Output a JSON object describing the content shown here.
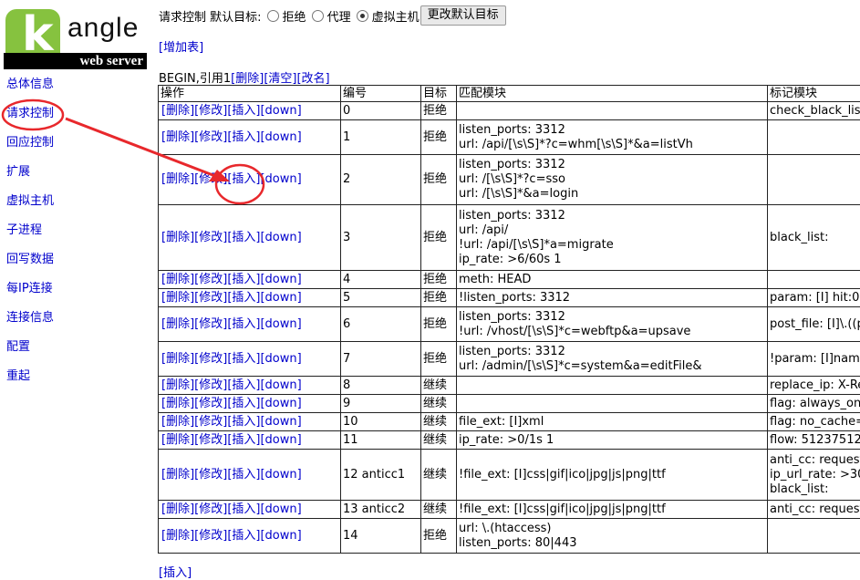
{
  "logo": {
    "letter": "k",
    "word": "angle",
    "tagline": "web server"
  },
  "sidebar": {
    "items": [
      {
        "label": "总体信息"
      },
      {
        "label": "请求控制"
      },
      {
        "label": "回应控制"
      },
      {
        "label": "扩展"
      },
      {
        "label": "虚拟主机"
      },
      {
        "label": "子进程"
      },
      {
        "label": "回写数据"
      },
      {
        "label": "每IP连接"
      },
      {
        "label": "连接信息"
      },
      {
        "label": "配置"
      },
      {
        "label": "重起"
      }
    ]
  },
  "topbar": {
    "title": "请求控制",
    "default_target_label": "默认目标:",
    "options": [
      {
        "label": "拒绝",
        "checked": false
      },
      {
        "label": "代理",
        "checked": false
      },
      {
        "label": "虚拟主机",
        "checked": true
      }
    ],
    "change_button": "更改默认目标"
  },
  "add_table": "[增加表]",
  "table_info": {
    "prefix": "BEGIN,引用1",
    "delete": "[删除]",
    "clear": "[清空]",
    "rename": "[改名]"
  },
  "table": {
    "headers": [
      "操作",
      "编号",
      "目标",
      "匹配模块",
      "标记模块"
    ],
    "op_links": {
      "delete": "[删除]",
      "modify": "[修改]",
      "insert": "[插入]",
      "down": "[down]"
    },
    "rows": [
      {
        "num": "0",
        "target": "拒绝",
        "match": [],
        "mark": [
          "check_black_list"
        ]
      },
      {
        "num": "1",
        "target": "拒绝",
        "match": [
          "listen_ports: 3312",
          "url: /api/[\\s\\S]*?c=whm[\\s\\S]*&a=listVh"
        ],
        "mark": []
      },
      {
        "num": "2",
        "target": "拒绝",
        "match": [
          "listen_ports: 3312",
          "url: /[\\s\\S]*?c=sso",
          "url: /[\\s\\S]*&a=login"
        ],
        "mark": []
      },
      {
        "num": "3",
        "target": "拒绝",
        "match": [
          "listen_ports: 3312",
          "url: /api/",
          "!url: /api/[\\s\\S]*a=migrate",
          "ip_rate: >6/60s 1"
        ],
        "mark": [
          "black_list:"
        ]
      },
      {
        "num": "4",
        "target": "拒绝",
        "match": [
          "meth: HEAD"
        ],
        "mark": []
      },
      {
        "num": "5",
        "target": "拒绝",
        "match": [
          "!listen_ports: 3312"
        ],
        "mark": [
          "param: [I] hit:0"
        ]
      },
      {
        "num": "6",
        "target": "拒绝",
        "match": [
          "listen_ports: 3312",
          "!url: /vhost/[\\s\\S]*c=webftp&a=upsave"
        ],
        "mark": [
          "post_file: [I]\\.((p"
        ]
      },
      {
        "num": "7",
        "target": "拒绝",
        "match": [
          "listen_ports: 3312",
          "url: /admin/[\\s\\S]*c=system&a=editFile&"
        ],
        "mark": [
          "!param: [I]name"
        ]
      },
      {
        "num": "8",
        "target": "继续",
        "match": [],
        "mark": [
          "replace_ip: X-Re"
        ]
      },
      {
        "num": "9",
        "target": "继续",
        "match": [],
        "mark": [
          "flag: always_onl"
        ]
      },
      {
        "num": "10",
        "target": "继续",
        "match": [
          "file_ext: [I]xml"
        ],
        "mark": [
          "flag: no_cache="
        ]
      },
      {
        "num": "11",
        "target": "继续",
        "match": [
          "ip_rate: >0/1s 1"
        ],
        "mark": [
          "flow: 51237512"
        ]
      },
      {
        "num": "12 anticc1",
        "target": "继续",
        "match": [
          "!file_ext: [I]css|gif|ico|jpg|js|png|ttf"
        ],
        "mark": [
          "anti_cc: request",
          "ip_url_rate: >30",
          "black_list:"
        ]
      },
      {
        "num": "13 anticc2",
        "target": "继续",
        "match": [
          "!file_ext: [I]css|gif|ico|jpg|js|png|ttf"
        ],
        "mark": [
          "anti_cc: request"
        ]
      },
      {
        "num": "14",
        "target": "拒绝",
        "match": [
          "url: \\.(htaccess)",
          "listen_ports: 80|443"
        ],
        "mark": []
      }
    ]
  },
  "bottom_insert": "[插入]",
  "annotation_color": "#e8282c"
}
